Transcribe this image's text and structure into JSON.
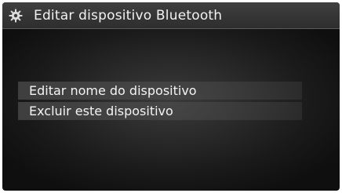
{
  "header": {
    "icon": "gear-settings-icon",
    "title": "Editar dispositivo Bluetooth"
  },
  "menu": {
    "items": [
      {
        "label": "Editar nome do dispositivo"
      },
      {
        "label": "Excluir este dispositivo"
      }
    ]
  },
  "colors": {
    "background": "#1e1e1e",
    "header": "#363636",
    "item_highlight": "#5a5a5a",
    "text": "#f2f2f2"
  }
}
